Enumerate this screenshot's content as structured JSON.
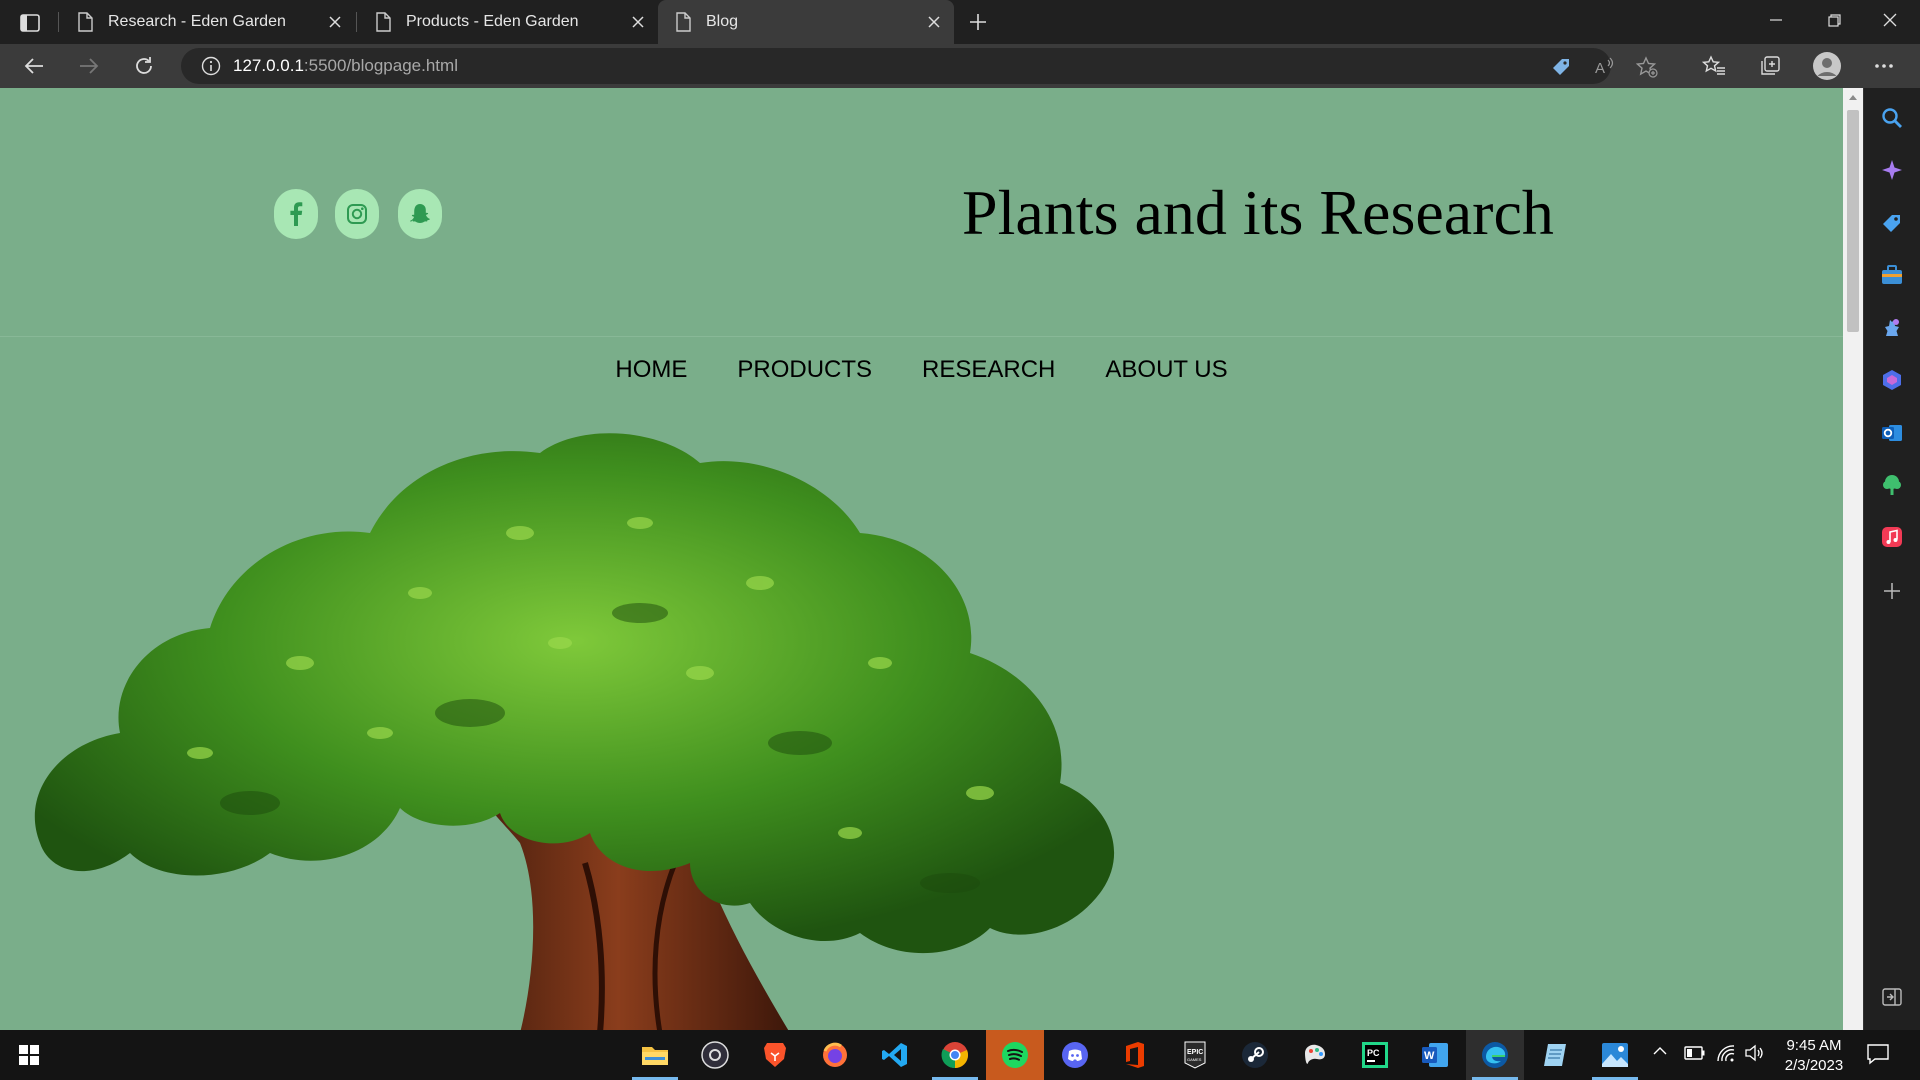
{
  "browser": {
    "tabs": [
      {
        "title": "Research - Eden Garden",
        "active": false
      },
      {
        "title": "Products - Eden Garden",
        "active": false
      },
      {
        "title": "Blog",
        "active": true
      }
    ],
    "address": {
      "host": "127.0.0.1",
      "rest": ":5500/blogpage.html"
    }
  },
  "page": {
    "title": "Plants and its Research",
    "social": [
      "facebook-icon",
      "instagram-icon",
      "snapchat-icon"
    ],
    "nav": [
      "HOME",
      "PRODUCTS",
      "RESEARCH",
      "ABOUT US"
    ],
    "colors": {
      "background": "#7aae8a",
      "social_bg": "#a8e7b4",
      "social_icon": "#2e9a52"
    }
  },
  "taskbar": {
    "time": "9:45 AM",
    "date": "2/3/2023"
  }
}
